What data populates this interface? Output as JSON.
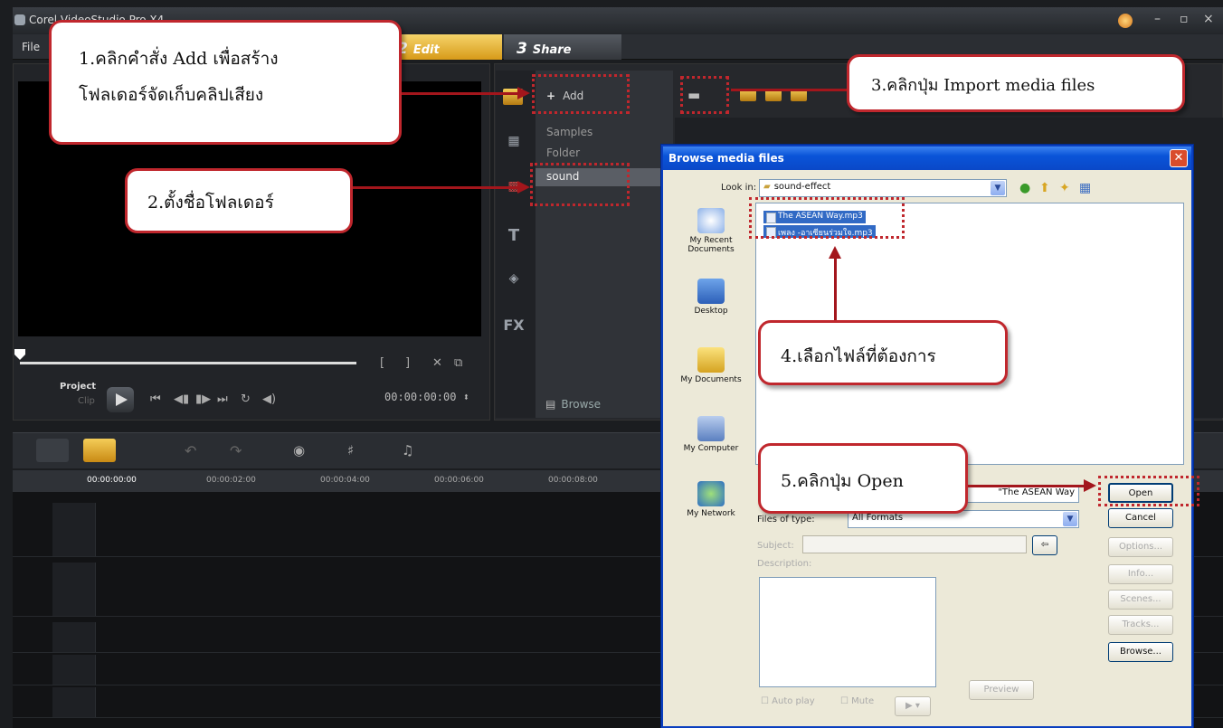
{
  "app": {
    "title": "Corel VideoStudio Pro X4",
    "menu_file": "File",
    "steps": [
      {
        "num": "2",
        "label": "Edit"
      },
      {
        "num": "3",
        "label": "Share"
      }
    ],
    "window_controls": [
      "–",
      "▫",
      "×"
    ]
  },
  "preview": {
    "project_label": "Project",
    "clip_label": "Clip",
    "timecode": "00:00:00:00 ⬍"
  },
  "library": {
    "add_label": "Add",
    "folders": [
      "Samples",
      "Folder"
    ],
    "new_folder_name": "sound",
    "browse_label": "Browse",
    "fx_label": "FX",
    "title_icon_glyph": "T"
  },
  "timeline": {
    "ruler_labels": [
      "00:00:00:00",
      "00:00:02:00",
      "00:00:04:00",
      "00:00:06:00",
      "00:00:08:00"
    ]
  },
  "dialog": {
    "title": "Browse media files",
    "close_glyph": "✕",
    "look_in_label": "Look in:",
    "look_in_value": "sound-effect",
    "places": [
      "My Recent Documents",
      "Desktop",
      "My Documents",
      "My Computer",
      "My Network"
    ],
    "files": [
      "The ASEAN Way.mp3",
      "เพลง -อาเซียนร่วมใจ.mp3"
    ],
    "file_name_value": "\"The ASEAN Way",
    "files_of_type_label": "Files of type:",
    "files_of_type_value": "All Formats",
    "subject_label": "Subject:",
    "description_label": "Description:",
    "buttons": {
      "open": "Open",
      "cancel": "Cancel",
      "options": "Options...",
      "info": "Info...",
      "scenes": "Scenes...",
      "tracks": "Tracks...",
      "browse": "Browse...",
      "preview": "Preview"
    },
    "autoplay_label": "Auto play",
    "mute_label": "Mute"
  },
  "annotations": {
    "step1_line1": "1.คลิกคำสั่ง Add เพื่อสร้าง",
    "step1_line2": "โฟลเดอร์จัดเก็บคลิปเสียง",
    "step2": "2.ตั้งชื่อโฟลเดอร์",
    "step3": "3.คลิกปุ่ม Import media files",
    "step4": "4.เลือกไฟล์ที่ต้องการ",
    "step5": "5.คลิกปุ่ม Open"
  },
  "colors": {
    "annotation_red": "#c0272d",
    "xp_title_blue": "#0a54d8",
    "edit_tab_gold": "#e8b93a"
  }
}
